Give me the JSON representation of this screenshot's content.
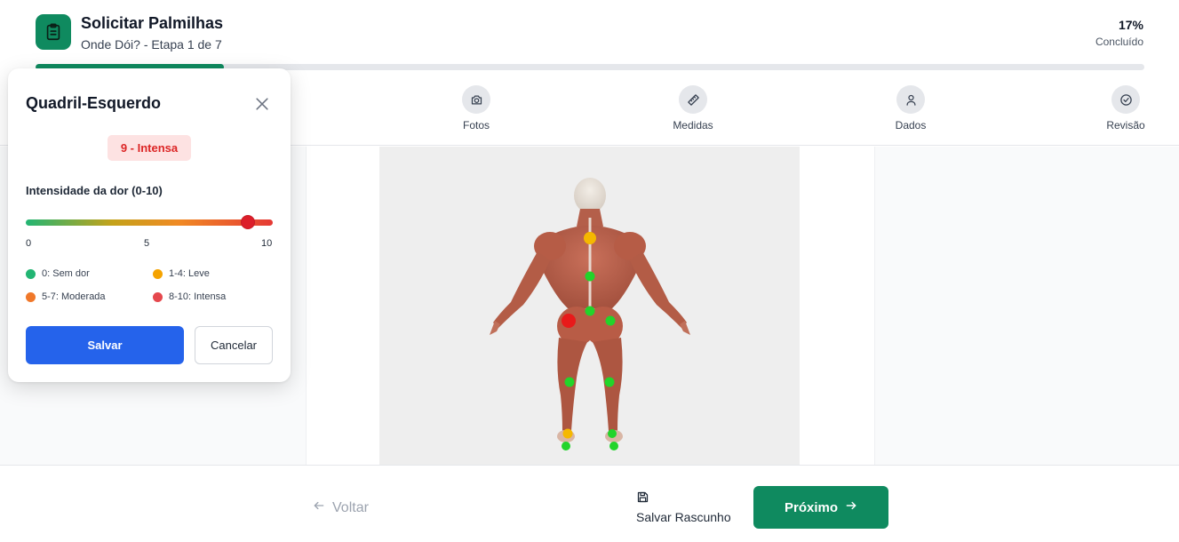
{
  "header": {
    "title": "Solicitar Palmilhas",
    "subtitle": "Onde Dói? - Etapa 1 de 7",
    "progress_percent_label": "17%",
    "progress_status": "Concluído",
    "progress_fraction": 0.17,
    "brand_color": "#0f8a5f"
  },
  "steps": [
    {
      "label": "Fotos",
      "icon": "camera-icon"
    },
    {
      "label": "Medidas",
      "icon": "ruler-icon"
    },
    {
      "label": "Dados",
      "icon": "user-icon"
    },
    {
      "label": "Revisão",
      "icon": "check-circle-icon"
    }
  ],
  "popup": {
    "title": "Quadril-Esquerdo",
    "badge": "9 - Intensa",
    "intensity_label": "Intensidade da dor (0-10)",
    "slider": {
      "min": 0,
      "max": 10,
      "value": 9,
      "ticks": [
        "0",
        "5",
        "10"
      ]
    },
    "legend": [
      {
        "label": "0: Sem dor",
        "color": "#22b573"
      },
      {
        "label": "1-4: Leve",
        "color": "#f5a300"
      },
      {
        "label": "5-7: Moderada",
        "color": "#f0782a"
      },
      {
        "label": "8-10: Intensa",
        "color": "#e5484d"
      }
    ],
    "save_label": "Salvar",
    "cancel_label": "Cancelar"
  },
  "footer": {
    "back_label": "Voltar",
    "draft_label": "Salvar Rascunho",
    "next_label": "Próximo"
  }
}
